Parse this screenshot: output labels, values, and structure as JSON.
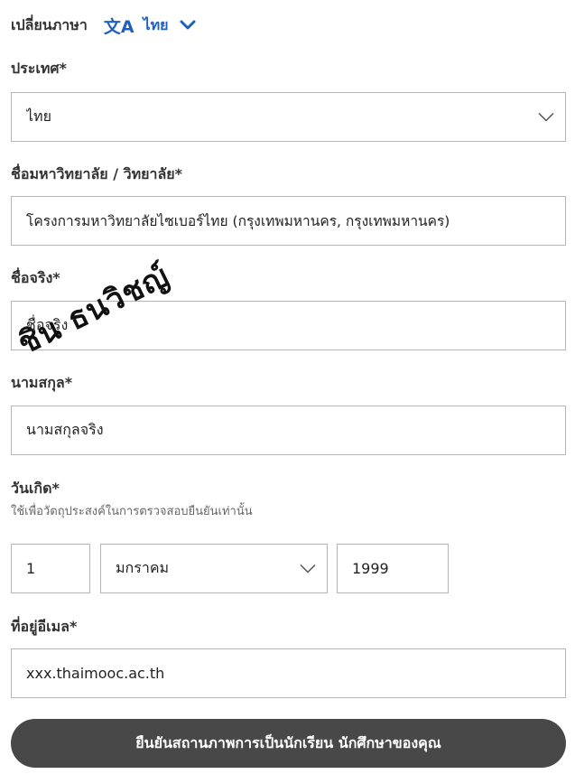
{
  "language": {
    "label": "เปลี่ยนภาษา",
    "icon": "translate-icon",
    "icon_glyph": "文A",
    "value": "ไทย"
  },
  "country": {
    "label": "ประเทศ*",
    "value": "ไทย"
  },
  "university": {
    "label": "ชื่อมหาวิทยาลัย / วิทยาลัย*",
    "value": "โครงการมหาวิทยาลัยไซเบอร์ไทย (กรุงเทพมหานคร, กรุงเทพมหานคร)"
  },
  "first_name": {
    "label": "ชื่อจริง*",
    "value": "ชื่อจริง"
  },
  "last_name": {
    "label": "นามสกุล*",
    "value": "นามสกุลจริง"
  },
  "birthdate": {
    "label": "วันเกิด*",
    "helper": "ใช้เพื่อวัตถุประสงค์ในการตรวจสอบยืนยันเท่านั้น",
    "day": "1",
    "month": "มกราคม",
    "year": "1999"
  },
  "email": {
    "label": "ที่อยู่อีเมล*",
    "value": "xxx.thaimooc.ac.th"
  },
  "submit_label": "ยืนยันสถานภาพการเป็นนักเรียน นักศึกษาของคุณ",
  "signature_text": "ชิน ธนวิชญ์",
  "colors": {
    "accent": "#1f5fbf",
    "button_bg": "#484848",
    "border": "#b5b5b5"
  }
}
